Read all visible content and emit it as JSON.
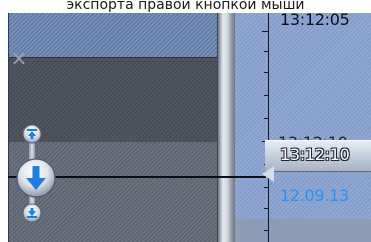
{
  "caption": {
    "text": "экспорта правой кнопкой мыши"
  },
  "timeline": {
    "time_top": "13:12:05",
    "time_mid_ghost": "13:12:10",
    "playhead_time": "13:12:10",
    "date": "12.09.13"
  },
  "controls": {
    "close_glyph": "×",
    "nav_top_icon": "step-to-start-icon",
    "nav_mid_icon": "arrow-down-icon",
    "nav_bottom_icon": "step-to-end-icon"
  },
  "colors": {
    "accent_blue": "#2e8ff2",
    "timeline_bg": "#8aa4d2",
    "panel_bg": "#4d525c"
  }
}
